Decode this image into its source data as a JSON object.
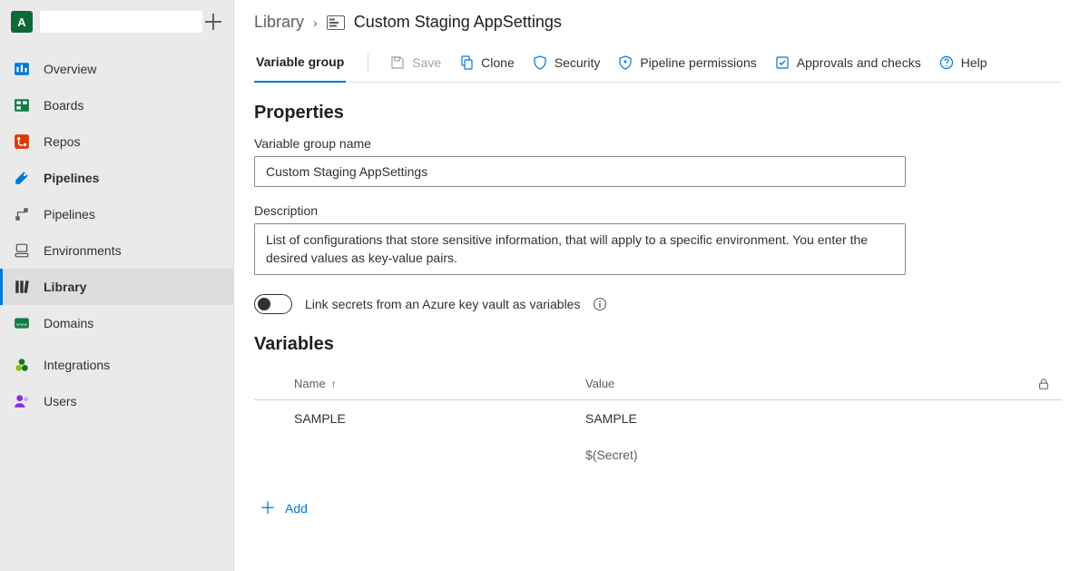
{
  "sidebar": {
    "org_initial": "A",
    "items": [
      {
        "label": "Overview"
      },
      {
        "label": "Boards"
      },
      {
        "label": "Repos"
      },
      {
        "label": "Pipelines"
      },
      {
        "label": "Pipelines"
      },
      {
        "label": "Environments"
      },
      {
        "label": "Library"
      },
      {
        "label": "Domains"
      },
      {
        "label": "Integrations"
      },
      {
        "label": "Users"
      }
    ]
  },
  "breadcrumb": {
    "root": "Library",
    "current": "Custom Staging AppSettings"
  },
  "toolbar": {
    "tab": "Variable group",
    "save": "Save",
    "clone": "Clone",
    "security": "Security",
    "pipeline_permissions": "Pipeline permissions",
    "approvals": "Approvals and checks",
    "help": "Help"
  },
  "sections": {
    "properties": "Properties",
    "variables": "Variables"
  },
  "fields": {
    "name_label": "Variable group name",
    "name_value": "Custom Staging AppSettings",
    "desc_label": "Description",
    "desc_value": "List of configurations that store sensitive information, that will apply to a specific environment. You enter the desired values as key-value pairs.",
    "link_secrets_label": "Link secrets from an Azure key vault as variables"
  },
  "var_table": {
    "col_name": "Name",
    "col_value": "Value",
    "rows": [
      {
        "name": "SAMPLE",
        "value": "SAMPLE"
      },
      {
        "name": "",
        "value": "$(Secret)"
      }
    ]
  },
  "add_label": "Add"
}
